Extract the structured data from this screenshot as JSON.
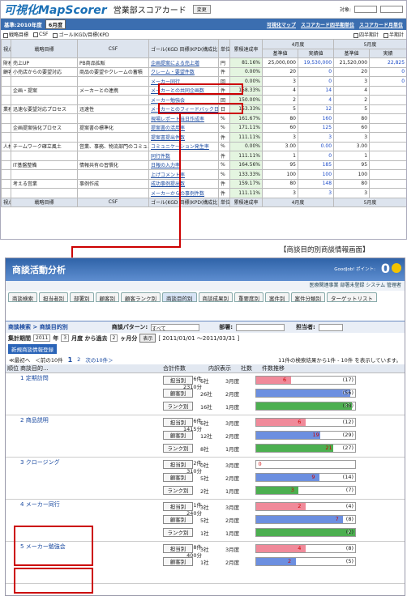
{
  "top": {
    "logo": "可視化MapScorer",
    "title": "営業部スコアカード",
    "change_btn": "変更",
    "target_label": "対象:",
    "year_label": "基準:2010年度",
    "month": "6月度",
    "links": [
      "可視化マップ",
      "スコアカード四半期単位",
      "スコアカード月単位"
    ],
    "checks": [
      "戦略目標",
      "CSF",
      "ゴール(KGD/目標(KPD"
    ],
    "right_checks": [
      "四半期計",
      "半期計"
    ],
    "headers": [
      "視点",
      "戦略目標",
      "CSF",
      "ゴール(KGD\n目標(KPD(構成比)",
      "単位",
      "累積達成率",
      "4月度",
      "5月度"
    ],
    "sub_headers": [
      "基準値",
      "実績値",
      "基準値",
      "実績"
    ],
    "rows": [
      {
        "v": "財務",
        "obj": "売上UP",
        "csf": "PB商品拡販",
        "goal": "企画提案による売上増",
        "u": "円",
        "rate": "81.16%",
        "a1": "25,000,000",
        "a2": "19,530,000",
        "b1": "21,520,000",
        "b2": "22,825"
      },
      {
        "v": "顧客",
        "obj": "小売店からの要望対応",
        "csf": "商品の要望やクレームの蓄積",
        "goal": "クレーム・要望件数",
        "u": "件",
        "rate": "0.00%",
        "a1": "20",
        "a2": "0",
        "b1": "20",
        "b2": "0"
      },
      {
        "v": "",
        "obj": "",
        "csf": "",
        "goal": "メーカー同行",
        "u": "回",
        "rate": "0.00%",
        "a1": "3",
        "a2": "0",
        "b1": "3",
        "b2": "0"
      },
      {
        "v": "",
        "obj": "企画・提案",
        "csf": "メーカーとの連携",
        "goal": "メーカーとの共同企画数",
        "u": "件",
        "rate": "158.33%",
        "a1": "4",
        "a2": "14",
        "b1": "4",
        "b2": ""
      },
      {
        "v": "",
        "obj": "",
        "csf": "",
        "goal": "メーカー勉強会",
        "u": "回",
        "rate": "150.00%",
        "a1": "2",
        "a2": "4",
        "b1": "2",
        "b2": ""
      },
      {
        "v": "業務",
        "obj": "迅速な要望対応プロセス",
        "csf": "迅速性",
        "goal": "メーカーとのフィードバック日数",
        "u": "日",
        "rate": "153.33%",
        "a1": "5",
        "a2": "12",
        "b1": "5",
        "b2": ""
      },
      {
        "v": "",
        "obj": "",
        "csf": "",
        "goal": "現場レポート当日作成率",
        "u": "%",
        "rate": "161.67%",
        "a1": "80",
        "a2": "160",
        "b1": "80",
        "b2": ""
      },
      {
        "v": "",
        "obj": "企画提案強化プロセス",
        "csf": "提案書の標準化",
        "goal": "提案書の活用率",
        "u": "%",
        "rate": "171.11%",
        "a1": "60",
        "a2": "125",
        "b1": "60",
        "b2": ""
      },
      {
        "v": "",
        "obj": "",
        "csf": "",
        "goal": "提案書提出件数",
        "u": "件",
        "rate": "111.11%",
        "a1": "3",
        "a2": "3",
        "b1": "3",
        "b2": ""
      },
      {
        "v": "人材",
        "obj": "チームワーク確立風土",
        "csf": "営業、事務、物流部門のコミュニケーション",
        "goal": "コミュニケーション発生率",
        "u": "%",
        "rate": "0.00%",
        "a1": "3.00",
        "a2": "0.00",
        "b1": "3.00",
        "b2": ""
      },
      {
        "v": "",
        "obj": "",
        "csf": "",
        "goal": "同行件数",
        "u": "件",
        "rate": "111.11%",
        "a1": "1",
        "a2": "0",
        "b1": "1",
        "b2": ""
      },
      {
        "v": "",
        "obj": "IT基盤整備",
        "csf": "情報共有の習慣化",
        "goal": "日報の入力率",
        "u": "%",
        "rate": "164.56%",
        "a1": "95",
        "a2": "185",
        "b1": "95",
        "b2": ""
      },
      {
        "v": "",
        "obj": "",
        "csf": "",
        "goal": "上げコメント率",
        "u": "%",
        "rate": "133.33%",
        "a1": "100",
        "a2": "100",
        "b1": "100",
        "b2": ""
      },
      {
        "v": "",
        "obj": "考える営業",
        "csf": "事例作成",
        "goal": "成功事例提出数",
        "u": "件",
        "rate": "159.17%",
        "a1": "80",
        "a2": "148",
        "b1": "80",
        "b2": ""
      },
      {
        "v": "",
        "obj": "",
        "csf": "",
        "goal": "メーカーからの事例件数",
        "u": "件",
        "rate": "111.11%",
        "a1": "3",
        "a2": "3",
        "b1": "3",
        "b2": ""
      }
    ],
    "footer_months": [
      "4月度",
      "5月度"
    ]
  },
  "caption": "【商談目的別商談情報画面】",
  "bottom": {
    "title": "商談活動分析",
    "goodjob": "GoodJob! ポイント:",
    "points": "0",
    "sub": "医療関連事業 部署未登録 システム 管理者",
    "tabs": [
      "商談検索",
      "担当者別",
      "部署別",
      "顧客別",
      "顧客ランク別",
      "商談目的別",
      "商談成果別",
      "重要度別",
      "案件別",
      "案件分類別",
      "ターゲットリスト"
    ],
    "crumb": "商談検索 > 商談目的別",
    "pattern_label": "商談パターン:",
    "pattern_value": "すべて",
    "dept_label": "部署:",
    "person_label": "担当者:",
    "period_label": "集計期間",
    "period_year": "2011",
    "year_suffix": "年",
    "period_month": "3",
    "month_txt": "月度 から過去",
    "months_back": "2",
    "months_suffix": "ヶ月分",
    "show_btn": "表示",
    "range": "[ 2011/01/01 〜2011/03/31 ]",
    "new_btn": "新規商談情報登録",
    "pager_first": "≪最初へ",
    "pager_prev": "＜前の10件",
    "page1": "1",
    "page2": "2",
    "pager_next": "次の10件＞",
    "count_text": "11件の検索結果から1件 - 10件 を表示しています。",
    "list_headers": [
      "順位",
      "商談目的...",
      "合計件数",
      "内訳表示",
      "社数",
      "件数推移"
    ],
    "groups": [
      {
        "rank": "1",
        "name": "定期訪問",
        "total": "96件",
        "sub": "2310分",
        "rows": [
          {
            "b": "担当別",
            "c": "6社",
            "p": "3月度",
            "n": "6",
            "t": "(17)",
            "f": 0.35,
            "col": "#f08a9a"
          },
          {
            "b": "顧客別",
            "c": "26社",
            "p": "2月度",
            "n": "53",
            "t": "(56)",
            "f": 0.95,
            "col": "#6c8fe0"
          },
          {
            "b": "ランク別",
            "c": "16社",
            "p": "1月度",
            "n": "37",
            "t": "(38)",
            "f": 0.97,
            "col": "#4caf50"
          }
        ]
      },
      {
        "rank": "2",
        "name": "商品説明",
        "total": "46件",
        "sub": "1415分",
        "rows": [
          {
            "b": "担当別",
            "c": "6社",
            "p": "3月度",
            "n": "6",
            "t": "(12)",
            "f": 0.5,
            "col": "#f08a9a"
          },
          {
            "b": "顧客別",
            "c": "12社",
            "p": "2月度",
            "n": "19",
            "t": "(29)",
            "f": 0.65,
            "col": "#6c8fe0"
          },
          {
            "b": "ランク別",
            "c": "8社",
            "p": "1月度",
            "n": "21",
            "t": "(27)",
            "f": 0.78,
            "col": "#4caf50"
          }
        ]
      },
      {
        "rank": "3",
        "name": "クロージング",
        "total": "12件",
        "sub": "310分",
        "rows": [
          {
            "b": "担当別",
            "c": "0社",
            "p": "3月度",
            "n": "0",
            "t": "",
            "f": 0.0,
            "col": "#f08a9a"
          },
          {
            "b": "顧客別",
            "c": "5社",
            "p": "2月度",
            "n": "9",
            "t": "(14)",
            "f": 0.64,
            "col": "#6c8fe0"
          },
          {
            "b": "ランク別",
            "c": "2社",
            "p": "1月度",
            "n": "3",
            "t": "(7)",
            "f": 0.43,
            "col": "#4caf50"
          }
        ]
      },
      {
        "rank": "4",
        "name": "メーカー同行",
        "total": "11件",
        "sub": "240分",
        "rows": [
          {
            "b": "担当別",
            "c": "3社",
            "p": "3月度",
            "n": "2",
            "t": "(4)",
            "f": 0.5,
            "col": "#f08a9a"
          },
          {
            "b": "顧客別",
            "c": "5社",
            "p": "2月度",
            "n": "7",
            "t": "(8)",
            "f": 0.88,
            "col": "#6c8fe0"
          },
          {
            "b": "ランク別",
            "c": "1社",
            "p": "1月度",
            "n": "2",
            "t": "(2)",
            "f": 1.0,
            "col": "#4caf50"
          }
        ]
      },
      {
        "rank": "5",
        "name": "メーカー勉強会",
        "total": "8件",
        "sub": "400分",
        "rows": [
          {
            "b": "担当別",
            "c": "3社",
            "p": "3月度",
            "n": "4",
            "t": "(8)",
            "f": 0.5,
            "col": "#f08a9a"
          },
          {
            "b": "顧客別",
            "c": "1社",
            "p": "2月度",
            "n": "2",
            "t": "(5)",
            "f": 0.4,
            "col": "#6c8fe0"
          }
        ]
      }
    ]
  }
}
